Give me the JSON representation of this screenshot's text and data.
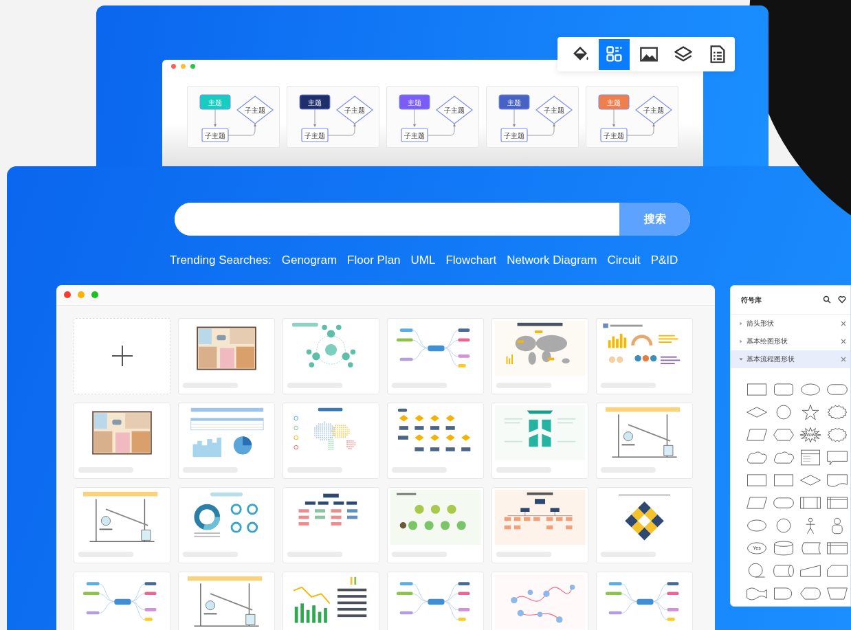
{
  "toolbar": [
    {
      "kind": "fill",
      "selected": false
    },
    {
      "kind": "templates",
      "selected": true
    },
    {
      "kind": "image",
      "selected": false
    },
    {
      "kind": "layers",
      "selected": false
    },
    {
      "kind": "outline",
      "selected": false
    }
  ],
  "theme_cards": [
    {
      "topic": "主题",
      "subtopics": [
        "子主题",
        "子主题"
      ],
      "color": "#17cdbf"
    },
    {
      "topic": "主题",
      "subtopics": [
        "子主题",
        "子主题"
      ],
      "color": "#1e2f6b"
    },
    {
      "topic": "主题",
      "subtopics": [
        "子主题",
        "子主题"
      ],
      "color": "#7b5cf5"
    },
    {
      "topic": "主题",
      "subtopics": [
        "子主题",
        "子主题"
      ],
      "color": "#4862c4"
    },
    {
      "topic": "主题",
      "subtopics": [
        "子主题",
        "子主题"
      ],
      "color": "#f07f4e"
    }
  ],
  "search": {
    "button": "搜索"
  },
  "trending": {
    "label": "Trending Searches:",
    "items": [
      "Genogram",
      "Floor Plan",
      "UML",
      "Flowchart",
      "Network Diagram",
      "Circuit",
      "P&ID"
    ]
  },
  "templates": [
    {
      "kind": "new"
    },
    {
      "kind": "floor-plan"
    },
    {
      "kind": "network"
    },
    {
      "kind": "mind-map"
    },
    {
      "kind": "world-map"
    },
    {
      "kind": "dashboard"
    },
    {
      "kind": "floor-plan"
    },
    {
      "kind": "report"
    },
    {
      "kind": "dot-map"
    },
    {
      "kind": "flowchart"
    },
    {
      "kind": "swot"
    },
    {
      "kind": "lab"
    },
    {
      "kind": "lab"
    },
    {
      "kind": "donut"
    },
    {
      "kind": "org-chart"
    },
    {
      "kind": "clouds"
    },
    {
      "kind": "org-tree"
    },
    {
      "kind": "diamond-matrix"
    },
    {
      "kind": "mind-map"
    },
    {
      "kind": "lab"
    },
    {
      "kind": "bar-chart"
    },
    {
      "kind": "mind-map"
    },
    {
      "kind": "bubble-map"
    },
    {
      "kind": "mind-map"
    }
  ],
  "symbol_library": {
    "title": "符号库",
    "categories": [
      {
        "label": "箭头形状",
        "expanded": false
      },
      {
        "label": "基本绘图形状",
        "expanded": false
      },
      {
        "label": "基本流程图形状",
        "expanded": true
      }
    ],
    "shapes": [
      {
        "kind": "rectangle"
      },
      {
        "kind": "rounded-rectangle"
      },
      {
        "kind": "ellipse"
      },
      {
        "kind": "stadium"
      },
      {
        "kind": "diamond"
      },
      {
        "kind": "circle"
      },
      {
        "kind": "star"
      },
      {
        "kind": "seal"
      },
      {
        "kind": "parallelogram"
      },
      {
        "kind": "hexagon"
      },
      {
        "kind": "burst",
        "label": "Wow!"
      },
      {
        "kind": "seal"
      },
      {
        "kind": "cloud"
      },
      {
        "kind": "cloud"
      },
      {
        "kind": "class"
      },
      {
        "kind": "callout"
      },
      {
        "kind": "rectangle"
      },
      {
        "kind": "rectangle"
      },
      {
        "kind": "diamond"
      },
      {
        "kind": "document"
      },
      {
        "kind": "parallelogram"
      },
      {
        "kind": "stadium"
      },
      {
        "kind": "predefined-process"
      },
      {
        "kind": "internal-storage"
      },
      {
        "kind": "ellipse"
      },
      {
        "kind": "circle"
      },
      {
        "kind": "actor"
      },
      {
        "kind": "person"
      },
      {
        "kind": "ellipse",
        "label": "Yes"
      },
      {
        "kind": "cylinder"
      },
      {
        "kind": "stored-data"
      },
      {
        "kind": "internal-storage"
      },
      {
        "kind": "sequential-data"
      },
      {
        "kind": "drum"
      },
      {
        "kind": "manual-input"
      },
      {
        "kind": "card"
      },
      {
        "kind": "tape"
      },
      {
        "kind": "delay"
      },
      {
        "kind": "display"
      },
      {
        "kind": "manual-operation"
      }
    ]
  }
}
